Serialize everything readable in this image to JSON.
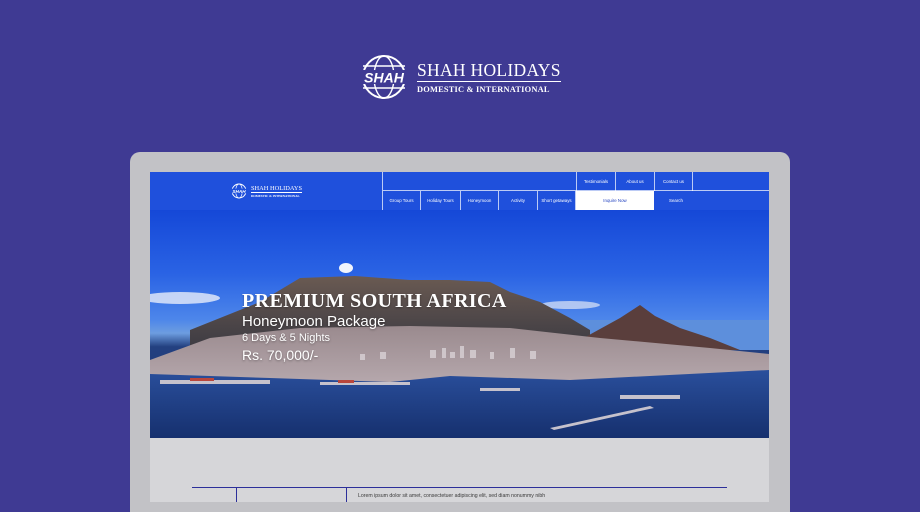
{
  "brand": {
    "mark_text": "SHAH",
    "name": "SHAH HOLIDAYS",
    "subtitle": "DOMESTIC & INTERNATIONAL",
    "icon": "globe-logo-icon"
  },
  "site": {
    "logo": {
      "mark_text": "SHAH",
      "name": "SHAH HOLIDAYS",
      "subtitle": "DOMESTIC & INTERNATIONAL"
    },
    "nav_top": [
      {
        "label": "Testimonials"
      },
      {
        "label": "About us"
      },
      {
        "label": "Contact us"
      }
    ],
    "nav_bottom": [
      {
        "label": "Group Tours"
      },
      {
        "label": "Holiday Tours"
      },
      {
        "label": "Honeymoon"
      },
      {
        "label": "Activity"
      },
      {
        "label": "Short getaways"
      },
      {
        "label": "Inquire Now"
      },
      {
        "label": "Search"
      }
    ]
  },
  "hero": {
    "title": "PREMIUM SOUTH AFRICA",
    "subtitle": "Honeymoon Package",
    "duration": "6 Days & 5 Nights",
    "price": "Rs. 70,000/-"
  },
  "content": {
    "text": "Lorem ipsum dolor sit amet, consectetuer adipiscing elit, sed diam nonummy nibh"
  },
  "colors": {
    "background": "#3f3a93",
    "header_blue": "#1f50dc",
    "laptop_frame": "#c2c2c6"
  }
}
